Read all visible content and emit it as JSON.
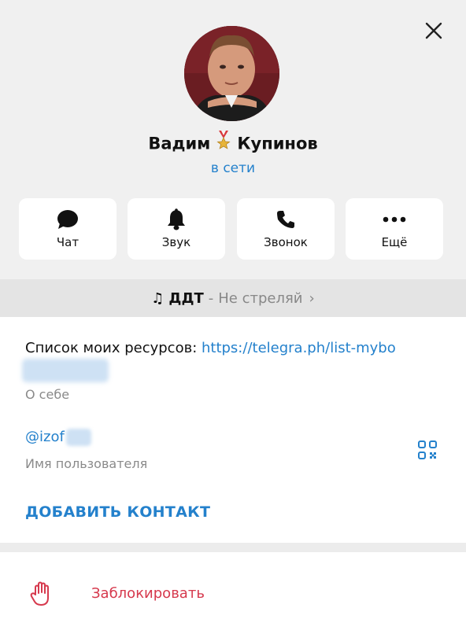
{
  "profile": {
    "first_name": "Вадим",
    "last_name": "Купинов",
    "status": "в сети"
  },
  "actions": [
    {
      "label": "Чат",
      "icon": "chat-bubble-icon"
    },
    {
      "label": "Звук",
      "icon": "bell-icon"
    },
    {
      "label": "Звонок",
      "icon": "phone-icon"
    },
    {
      "label": "Ещё",
      "icon": "more-dots-icon"
    }
  ],
  "music": {
    "artist": "ДДТ",
    "separator": "-",
    "song": "Не стреляй",
    "chevron": "›"
  },
  "info": {
    "bio_text": "Список моих ресурсов: ",
    "bio_link": "https://telegra.ph/list-mybo",
    "bio_caption": "О себе",
    "username": "@izof",
    "username_caption": "Имя пользователя",
    "add_contact": "ДОБАВИТЬ КОНТАКТ"
  },
  "block": {
    "label": "Заблокировать"
  },
  "colors": {
    "accent": "#2481cc",
    "danger": "#d6394d",
    "muted": "#8a8a8a"
  }
}
